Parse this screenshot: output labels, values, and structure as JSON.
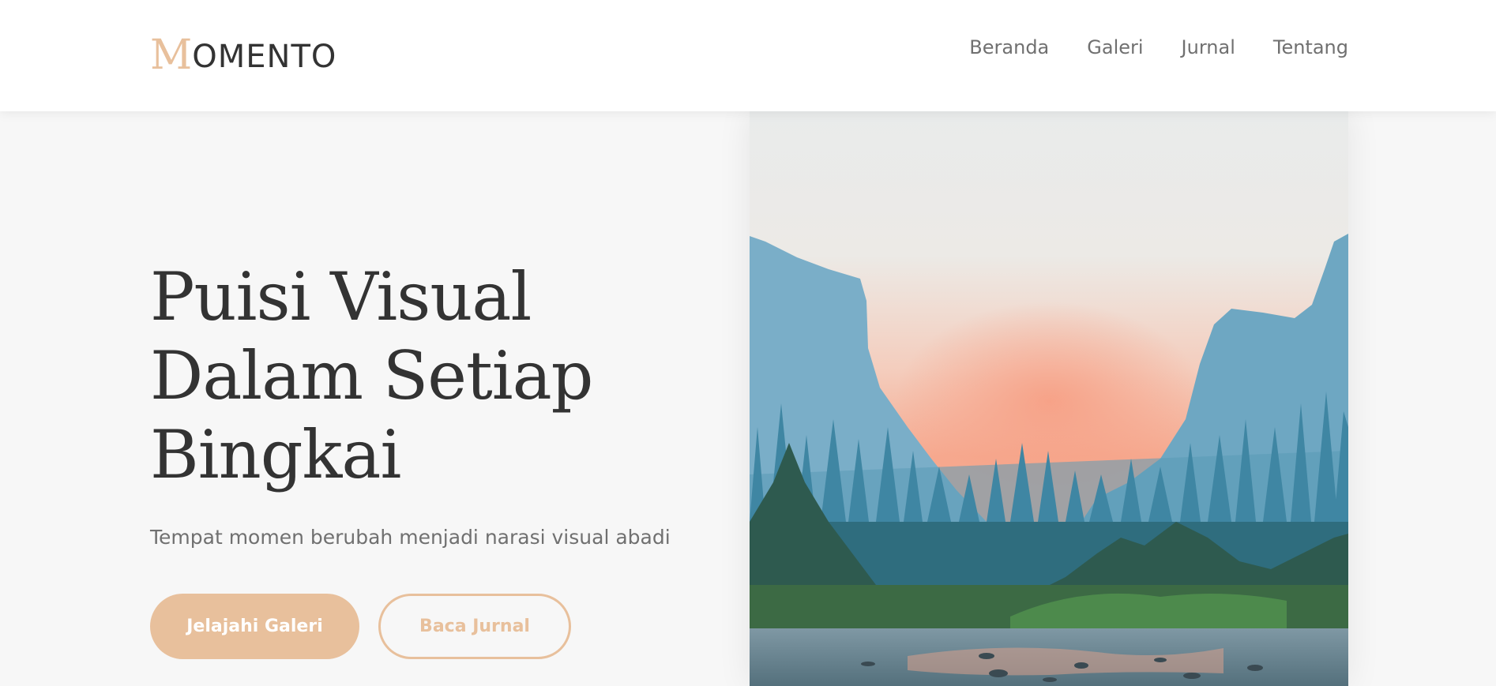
{
  "header": {
    "logo_initial": "M",
    "logo_rest": "OMENTO",
    "nav": [
      "Beranda",
      "Galeri",
      "Jurnal",
      "Tentang"
    ]
  },
  "hero": {
    "title_lines": [
      "Puisi Visual",
      "Dalam Setiap",
      "Bingkai"
    ],
    "subtitle": "Tempat momen berubah menjadi narasi visual abadi",
    "primary_button": "Jelajahi Galeri",
    "secondary_button": "Baca Jurnal",
    "image": "landscape-photo"
  },
  "colors": {
    "accent": "#e8c09c",
    "text_dark": "#333333",
    "text_muted": "#707070",
    "background": "#f7f7f7",
    "header_bg": "#ffffff"
  }
}
